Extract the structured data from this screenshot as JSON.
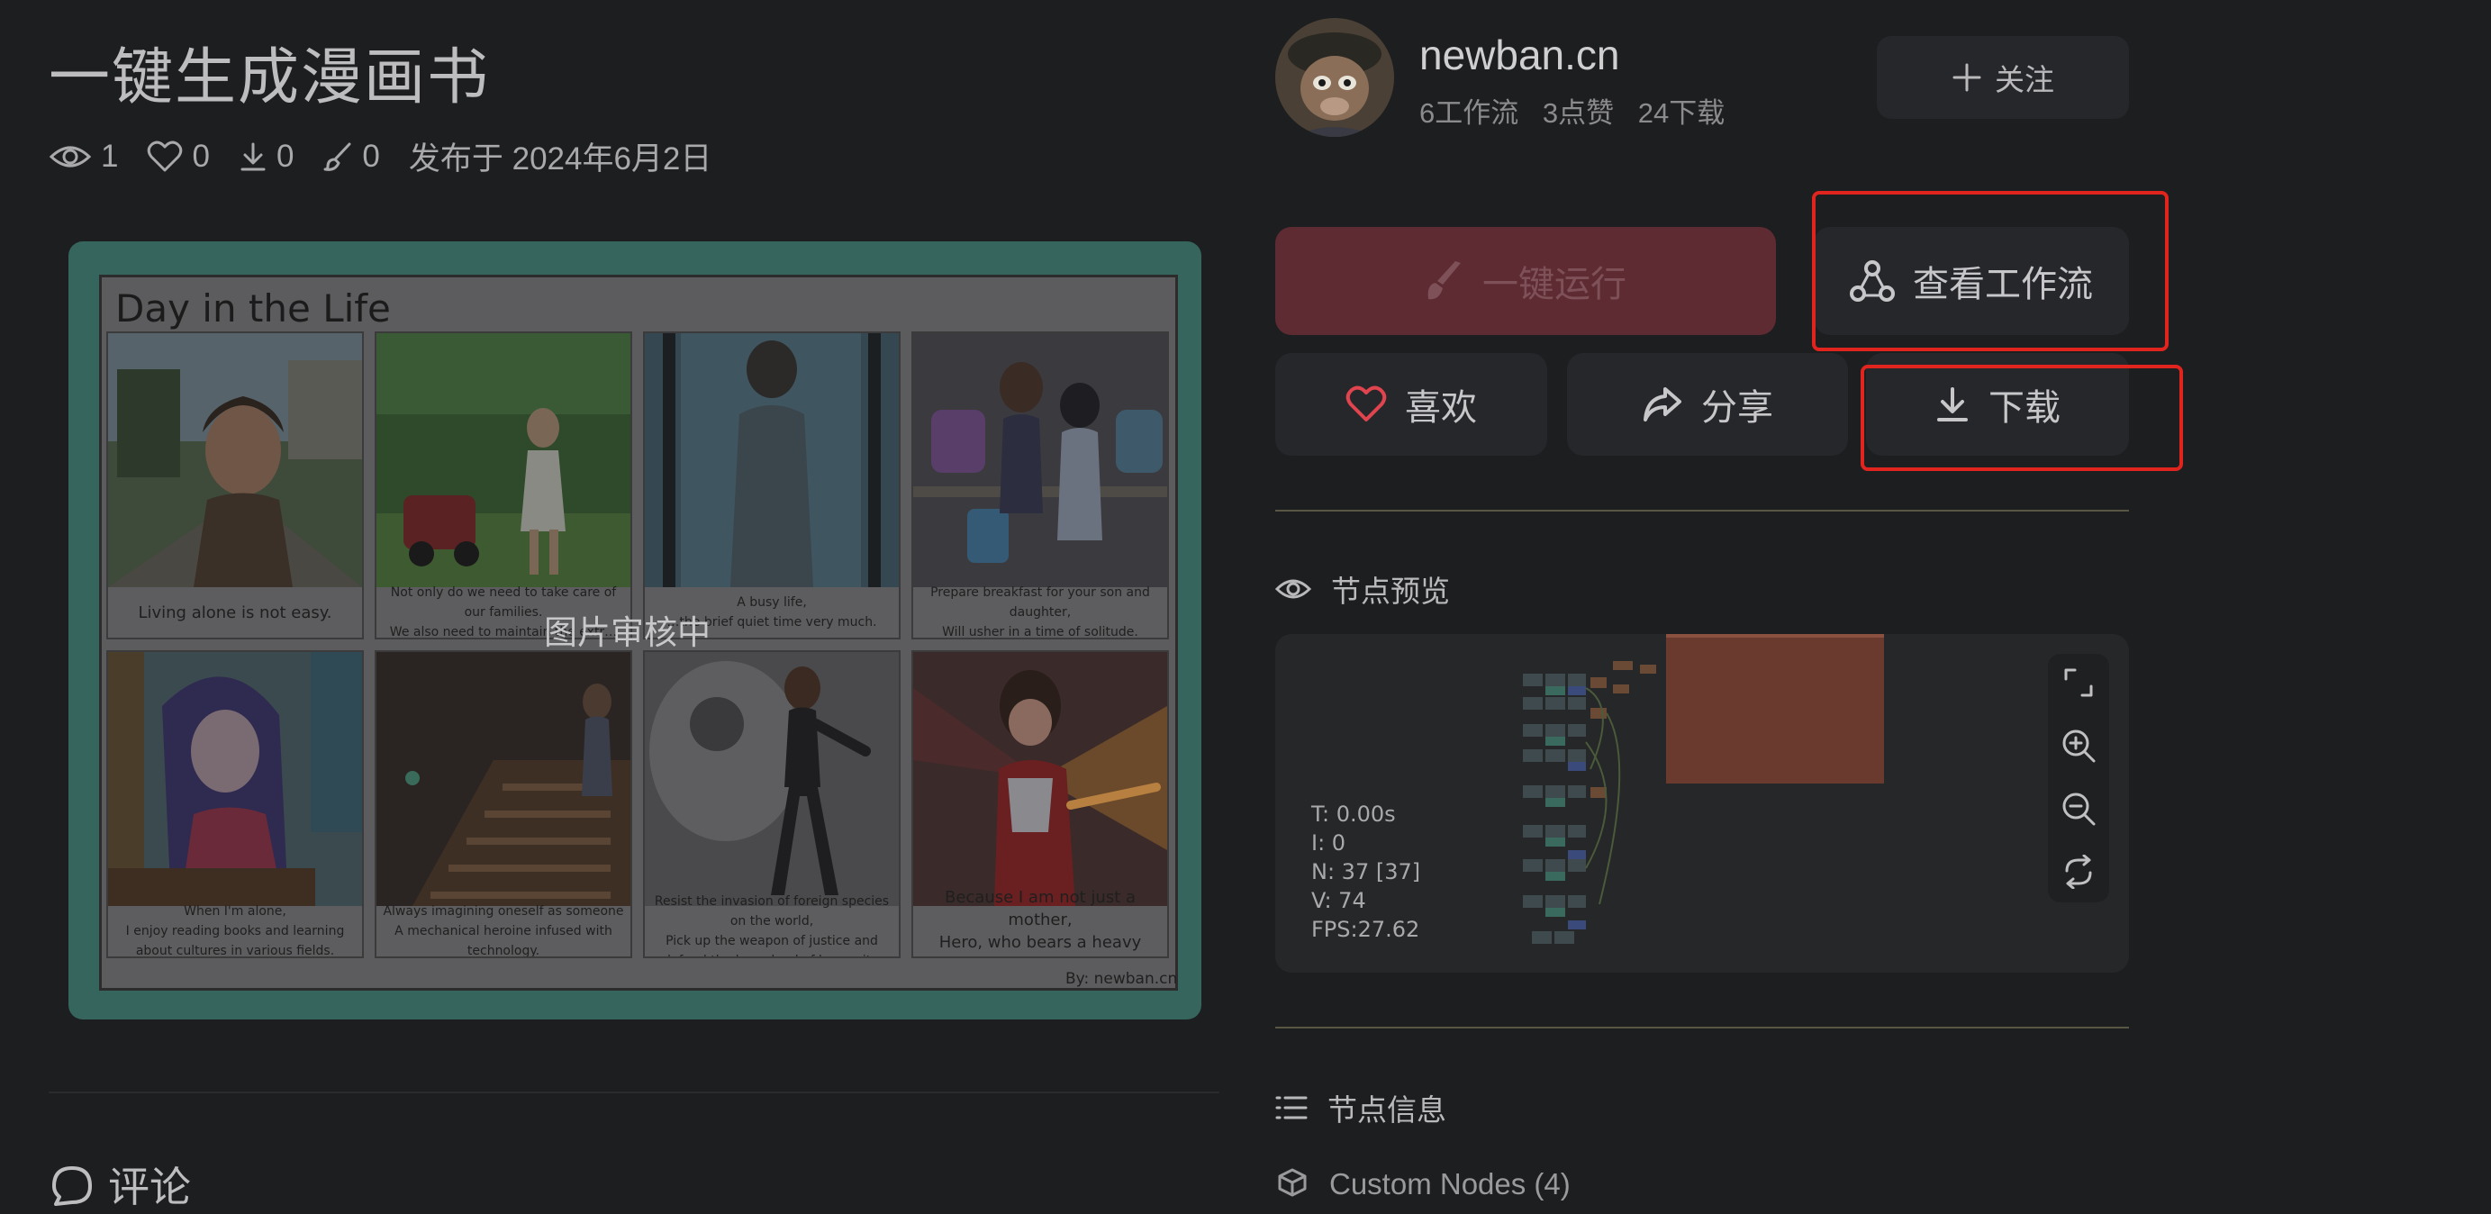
{
  "page": {
    "title": "一键生成漫画书",
    "stats": {
      "views": "1",
      "likes": "0",
      "downloads": "0",
      "uses": "0",
      "published": "发布于 2024年6月2日"
    }
  },
  "comic": {
    "heading": "Day in the Life",
    "panels": [
      {
        "caption": "Living alone is not easy."
      },
      {
        "caption": "Not only do we need to take care of our families.\nWe also need to maintain the extr…"
      },
      {
        "caption": "A busy life,\n…the brief quiet time very much."
      },
      {
        "caption": "Prepare breakfast for your son and daughter,\nWill usher in a time of solitude."
      },
      {
        "caption": "When I'm alone,\nI enjoy reading books and learning about cultures in various fields."
      },
      {
        "caption": "Always imagining oneself as someone\nA mechanical heroine infused with technology."
      },
      {
        "caption": "Resist the invasion of foreign species on the world,\nPick up the weapon of justice and defend the homeland of humanity."
      },
      {
        "caption": "Because I am not just a mother,\nHero, who bears a heavy burden!!"
      }
    ],
    "credit": "By: newban.cn",
    "overlay": "图片审核中"
  },
  "comments": {
    "label": "评论"
  },
  "author": {
    "name": "newban.cn",
    "workflows": "6工作流",
    "likes": "3点赞",
    "downloads": "24下载",
    "follow_label": "关注"
  },
  "actions": {
    "run": "一键运行",
    "view_workflow": "查看工作流",
    "like": "喜欢",
    "share": "分享",
    "download": "下载"
  },
  "node_preview": {
    "label": "节点预览",
    "stats": {
      "t": "T: 0.00s",
      "i": "I: 0",
      "n": "N: 37 [37]",
      "v": "V: 74",
      "fps": "FPS:27.62"
    }
  },
  "node_info": {
    "label": "节点信息",
    "custom_nodes": "Custom Nodes (4)"
  },
  "colors": {
    "highlight": "#e2241f",
    "run_button": "#5e2b33",
    "like_heart": "#e0444e",
    "background": "#1d1e20",
    "comic_frame": "#36655e"
  },
  "icons": [
    "eye-icon",
    "heart-icon",
    "download-icon",
    "brush-icon",
    "plus-icon",
    "workflow-icon",
    "share-icon",
    "list-icon",
    "fit-view-icon",
    "zoom-in-icon",
    "zoom-out-icon",
    "refresh-icon",
    "comment-icon",
    "cube-icon"
  ]
}
